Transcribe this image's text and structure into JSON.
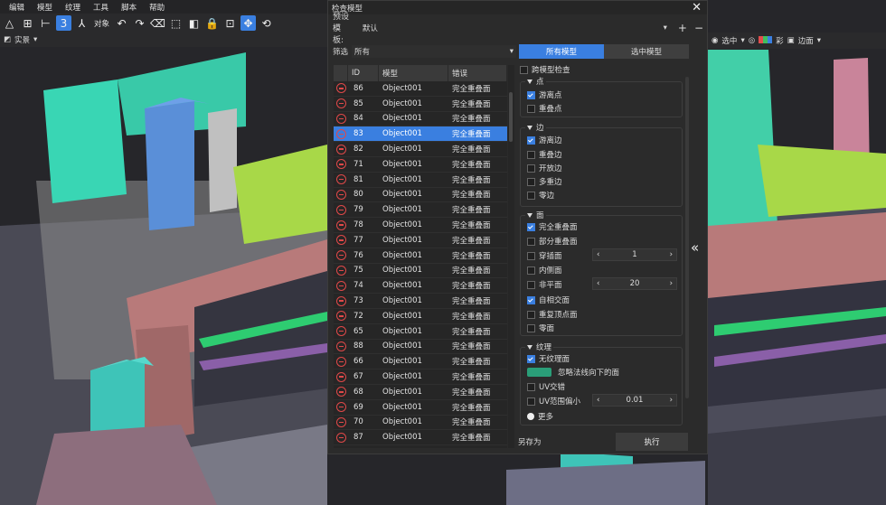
{
  "menu": [
    "编辑",
    "模型",
    "纹理",
    "工具",
    "脚本",
    "帮助"
  ],
  "toolbar": {
    "object_label": "对象"
  },
  "subbar": {
    "view_label": "实景"
  },
  "right_toolbar": {
    "select_label": "选中",
    "color_label": "彩",
    "edge_label": "边面"
  },
  "dialog": {
    "title": "检查模型",
    "preset_label": "预设模板:",
    "preset_value": "默认",
    "filter_label": "筛选",
    "filter_value": "所有",
    "tab_all": "所有模型",
    "tab_selected": "选中模型",
    "columns": {
      "id": "ID",
      "model": "模型",
      "error": "错误"
    },
    "rows": [
      {
        "id": "86",
        "model": "Object001",
        "error": "完全重叠面"
      },
      {
        "id": "85",
        "model": "Object001",
        "error": "完全重叠面"
      },
      {
        "id": "84",
        "model": "Object001",
        "error": "完全重叠面"
      },
      {
        "id": "83",
        "model": "Object001",
        "error": "完全重叠面"
      },
      {
        "id": "82",
        "model": "Object001",
        "error": "完全重叠面"
      },
      {
        "id": "71",
        "model": "Object001",
        "error": "完全重叠面"
      },
      {
        "id": "81",
        "model": "Object001",
        "error": "完全重叠面"
      },
      {
        "id": "80",
        "model": "Object001",
        "error": "完全重叠面"
      },
      {
        "id": "79",
        "model": "Object001",
        "error": "完全重叠面"
      },
      {
        "id": "78",
        "model": "Object001",
        "error": "完全重叠面"
      },
      {
        "id": "77",
        "model": "Object001",
        "error": "完全重叠面"
      },
      {
        "id": "76",
        "model": "Object001",
        "error": "完全重叠面"
      },
      {
        "id": "75",
        "model": "Object001",
        "error": "完全重叠面"
      },
      {
        "id": "74",
        "model": "Object001",
        "error": "完全重叠面"
      },
      {
        "id": "73",
        "model": "Object001",
        "error": "完全重叠面"
      },
      {
        "id": "72",
        "model": "Object001",
        "error": "完全重叠面"
      },
      {
        "id": "65",
        "model": "Object001",
        "error": "完全重叠面"
      },
      {
        "id": "88",
        "model": "Object001",
        "error": "完全重叠面"
      },
      {
        "id": "66",
        "model": "Object001",
        "error": "完全重叠面"
      },
      {
        "id": "67",
        "model": "Object001",
        "error": "完全重叠面"
      },
      {
        "id": "68",
        "model": "Object001",
        "error": "完全重叠面"
      },
      {
        "id": "69",
        "model": "Object001",
        "error": "完全重叠面"
      },
      {
        "id": "70",
        "model": "Object001",
        "error": "完全重叠面"
      },
      {
        "id": "87",
        "model": "Object001",
        "error": "完全重叠面"
      }
    ],
    "selected_row_id": "83",
    "cross_model_check": "跨模型检查",
    "groups": {
      "point": {
        "title": "点",
        "items": [
          {
            "label": "游离点",
            "checked": true
          },
          {
            "label": "重叠点",
            "checked": false
          }
        ]
      },
      "edge": {
        "title": "边",
        "items": [
          {
            "label": "游离边",
            "checked": true
          },
          {
            "label": "重叠边",
            "checked": false
          },
          {
            "label": "开放边",
            "checked": false
          },
          {
            "label": "多重边",
            "checked": false
          },
          {
            "label": "零边",
            "checked": false
          }
        ]
      },
      "face": {
        "title": "面",
        "items": [
          {
            "label": "完全重叠面",
            "checked": true
          },
          {
            "label": "部分重叠面",
            "checked": false
          },
          {
            "label": "穿插面",
            "checked": false
          },
          {
            "label": "内侧面",
            "checked": false
          },
          {
            "label": "非平面",
            "checked": false
          },
          {
            "label": "自相交面",
            "checked": true
          },
          {
            "label": "重复顶点面",
            "checked": false
          },
          {
            "label": "零面",
            "checked": false
          }
        ]
      },
      "texture": {
        "title": "纹理",
        "no_texture": "无纹理面",
        "ignore_normal": "忽略法线向下的面",
        "uv_cross": "UV交错",
        "uv_range": "UV范围偏小",
        "more": "更多"
      }
    },
    "intersect_value": "1",
    "nonplanar_value": "20",
    "uv_range_value": "0.01",
    "save_as": "另存为",
    "execute": "执行"
  }
}
